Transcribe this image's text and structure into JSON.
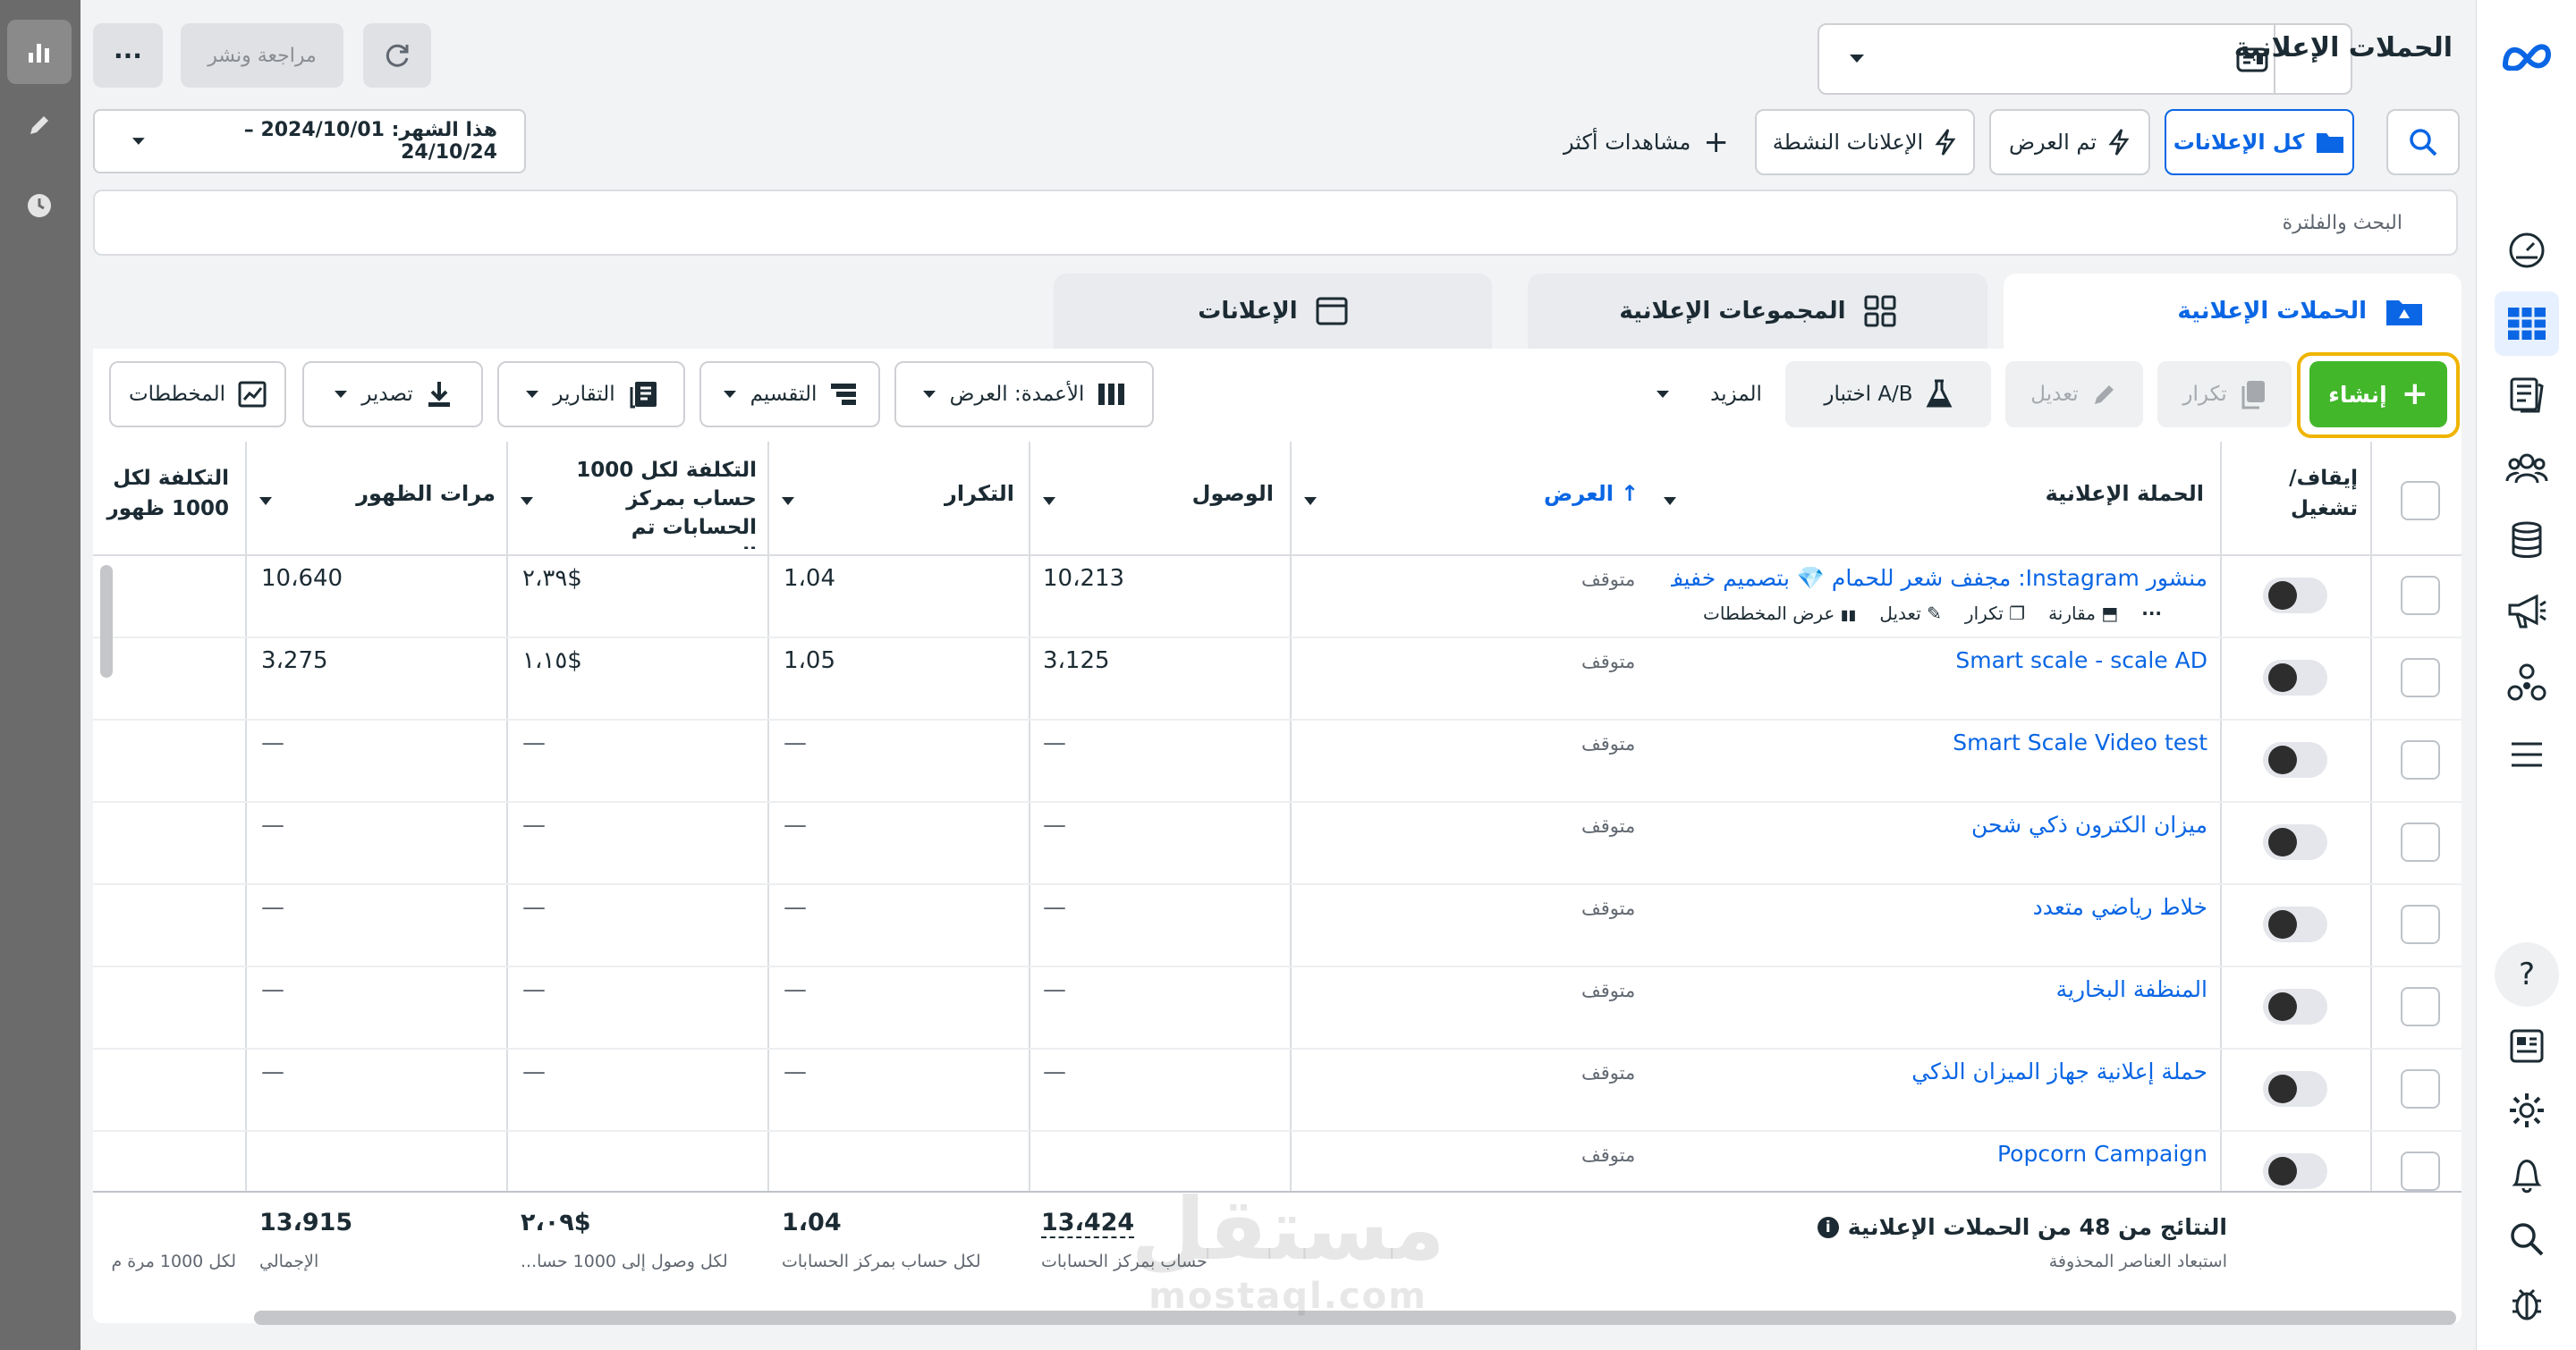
{
  "header": {
    "title": "الحملات الإعلانية",
    "review_publish": "مراجعة ونشر",
    "more": "···",
    "account_select_value": ""
  },
  "filters": {
    "all_ads": "كل الإعلانات",
    "delivered": "تم العرض",
    "active_ads": "الإعلانات النشطة",
    "more_views": "مشاهدات أكثر",
    "date_range": "هذا الشهر: 2024/10/01 – 24/10/24",
    "search_placeholder": "البحث والفلترة"
  },
  "tabs": {
    "campaigns": "الحملات الإعلانية",
    "ad_sets": "المجموعات الإعلانية",
    "ads": "الإعلانات"
  },
  "toolbar": {
    "create": "إنشاء",
    "duplicate": "تكرار",
    "edit": "تعديل",
    "ab_test": "اختبار A/B",
    "more": "المزيد",
    "columns": "الأعمدة: العرض",
    "breakdown": "التقسيم",
    "reports": "التقارير",
    "export": "تصدير",
    "charts": "المخططات"
  },
  "table": {
    "headers": {
      "toggle": "إيقاف/ تشغيل",
      "campaign": "الحملة الإعلانية",
      "delivery": "العرض",
      "reach": "الوصول",
      "frequency": "التكرار",
      "cost_per_1000": "التكلفة لكل 1000 حساب بمركز الحسابات تم الوصو...",
      "impressions": "مرات الظهور",
      "cpm": "التكلفة لكل 1000 ظهور"
    },
    "row_actions": {
      "view_charts": "عرض المخططات",
      "edit": "تعديل",
      "duplicate": "تكرار",
      "compare": "مقارنة",
      "more": "···"
    },
    "rows": [
      {
        "name": "منشور Instagram: مجفف شعر للحمام 💎 بتصميم خفيف...",
        "status": "متوقف",
        "reach": "10،213",
        "frequency": "1،04",
        "cost": "٢،٣٩$",
        "impressions": "10،640"
      },
      {
        "name": "Smart scale - scale AD",
        "status": "متوقف",
        "reach": "3،125",
        "frequency": "1،05",
        "cost": "١،١٥$",
        "impressions": "3،275"
      },
      {
        "name": "Smart Scale Video test",
        "status": "متوقف",
        "reach": "—",
        "frequency": "—",
        "cost": "—",
        "impressions": "—"
      },
      {
        "name": "ميزان الكترون ذكي شحن",
        "status": "متوقف",
        "reach": "—",
        "frequency": "—",
        "cost": "—",
        "impressions": "—"
      },
      {
        "name": "خلاط رياضي متعدد",
        "status": "متوقف",
        "reach": "—",
        "frequency": "—",
        "cost": "—",
        "impressions": "—"
      },
      {
        "name": "المنظفة البخارية",
        "status": "متوقف",
        "reach": "—",
        "frequency": "—",
        "cost": "—",
        "impressions": "—"
      },
      {
        "name": "حملة إعلانية جهاز الميزان الذكي",
        "status": "متوقف",
        "reach": "—",
        "frequency": "—",
        "cost": "—",
        "impressions": "—"
      },
      {
        "name": "Popcorn Campaign",
        "status": "متوقف",
        "reach": "",
        "frequency": "",
        "cost": "",
        "impressions": ""
      }
    ],
    "footer": {
      "results_title": "النتائج من 48 من الحملات الإعلانية",
      "results_sub": "استبعاد العناصر المحذوفة",
      "reach": "13،424",
      "reach_sub": "حساب بمركز الحسابات",
      "frequency": "1،04",
      "frequency_sub": "لكل حساب بمركز الحسابات",
      "cost": "٢،٠٩$",
      "cost_sub": "لكل وصول إلى 1000 حسا...",
      "impressions": "13،915",
      "impressions_sub": "الإجمالي",
      "cpm_sub": "لكل 1000 مرة م"
    }
  },
  "watermark": {
    "ar": "مستقل",
    "en": "mostaql.com"
  },
  "colors": {
    "accent": "#0a66e4",
    "create": "#42b72a",
    "highlight": "#f0b400"
  }
}
